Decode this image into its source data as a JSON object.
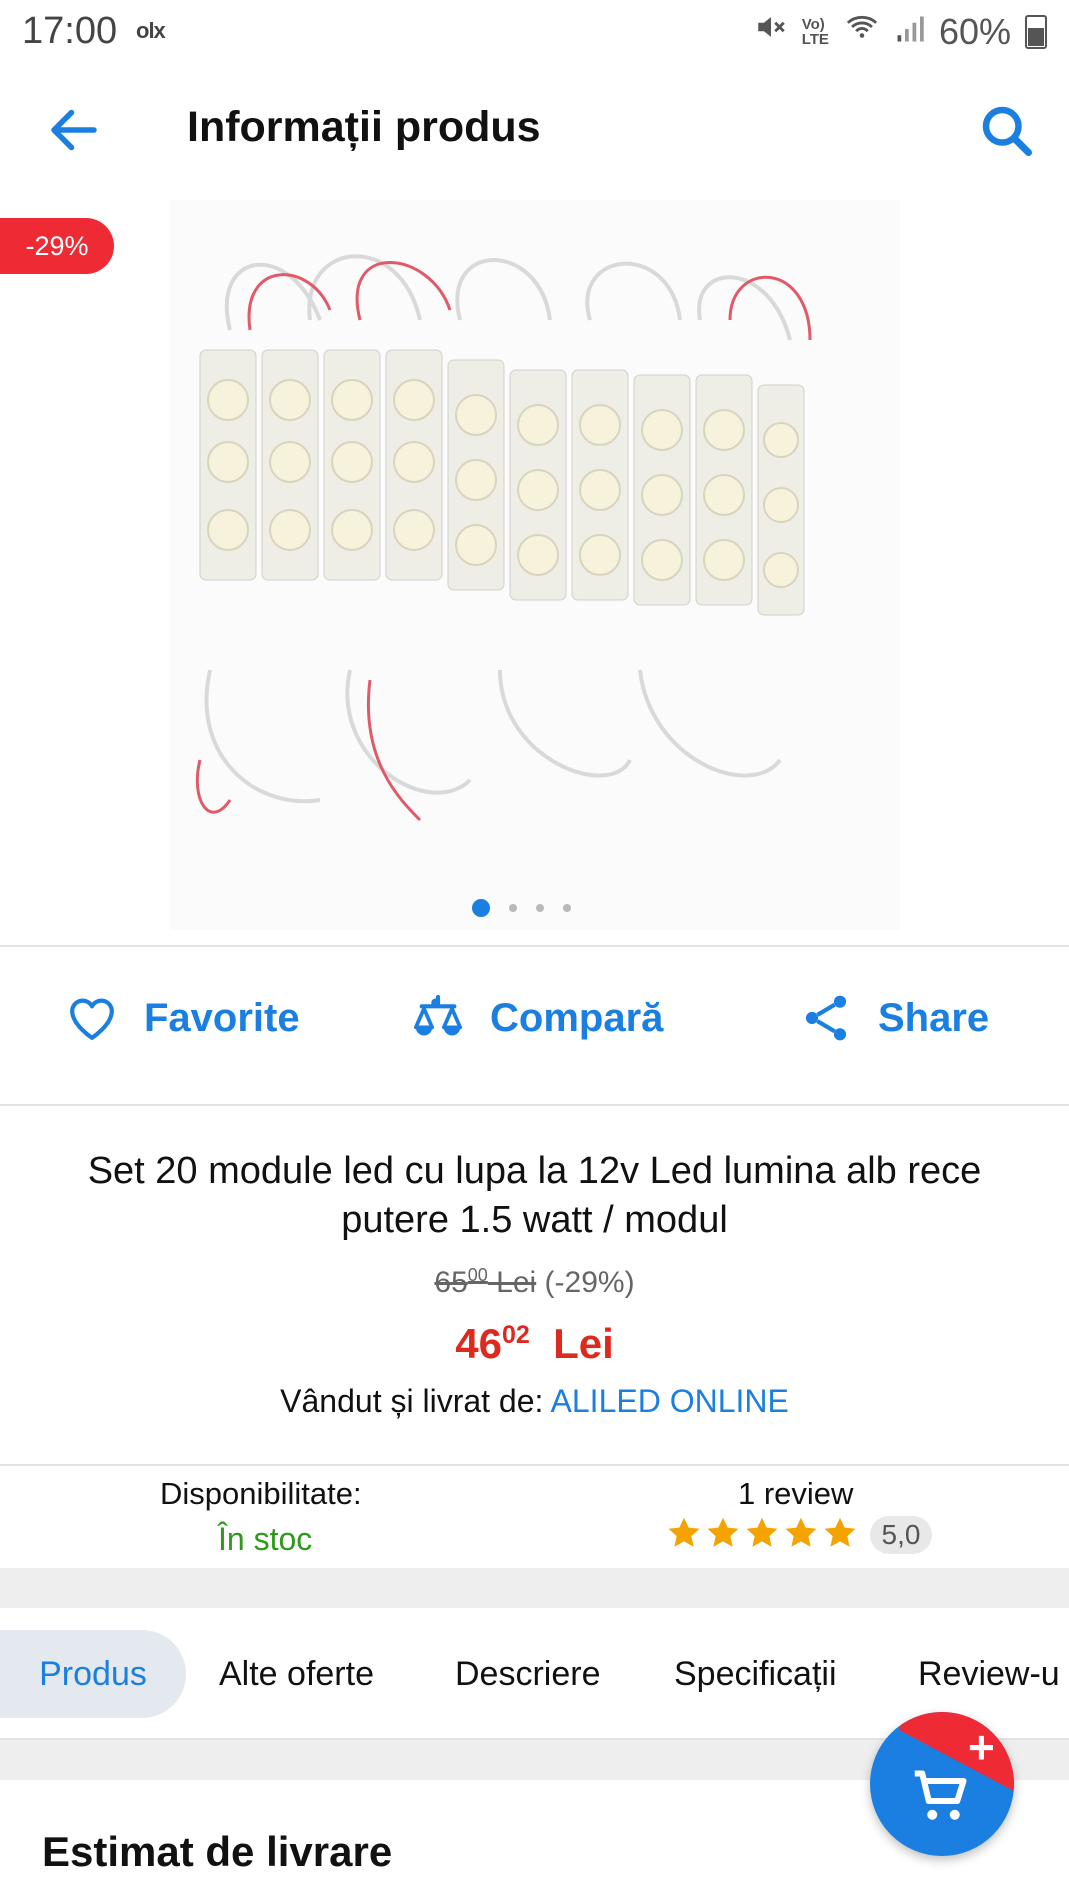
{
  "status_bar": {
    "time": "17:00",
    "brand": "olx",
    "battery": "60%"
  },
  "header": {
    "title": "Informații produs"
  },
  "gallery": {
    "discount_badge": "-29%",
    "dots_count": 4,
    "active_dot": 1
  },
  "actions": [
    {
      "label": "Favorite",
      "icon": "heart-icon"
    },
    {
      "label": "Compară",
      "icon": "scales-icon"
    },
    {
      "label": "Share",
      "icon": "share-icon"
    }
  ],
  "product": {
    "title": "Set 20 module led cu lupa la 12v Led lumina alb rece putere 1.5 watt / modul",
    "old_price_int": "65",
    "old_price_dec": "00",
    "old_price_currency": " Lei",
    "discount": "(-29%)",
    "price_int": "46",
    "price_dec": "02",
    "price_currency": "Lei",
    "seller_label": "Vândut și livrat de:",
    "seller_name": "ALILED ONLINE"
  },
  "availability": {
    "label": "Disponibilitate:",
    "value": "În stoc"
  },
  "reviews": {
    "count_label": "1 review",
    "rating": "5,0",
    "stars": 5
  },
  "tabs": [
    "Produs",
    "Alte oferte",
    "Descriere",
    "Specificații",
    "Review-u"
  ],
  "delivery": {
    "title": "Estimat de livrare"
  },
  "colors": {
    "accent": "#1a7fe0",
    "price_red": "#dc2a1f",
    "badge_red": "#ee2a35",
    "stock_green": "#2e9a1c",
    "star": "#f5a300"
  }
}
